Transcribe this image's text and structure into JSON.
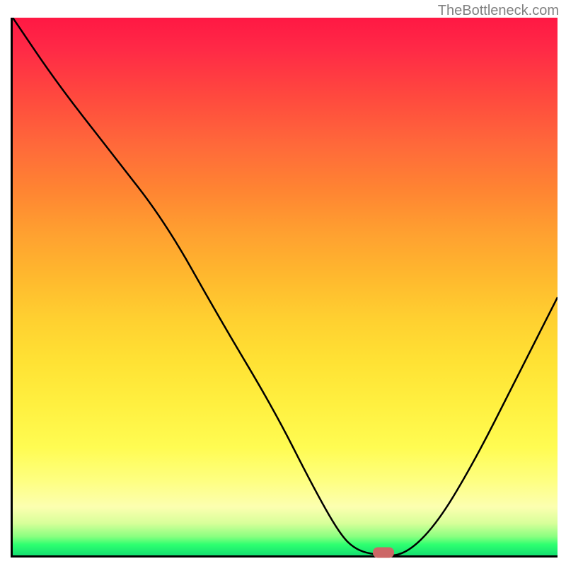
{
  "watermark": "TheBottleneck.com",
  "chart_data": {
    "type": "line",
    "title": "",
    "xlabel": "",
    "ylabel": "",
    "xlim": [
      0,
      100
    ],
    "ylim": [
      0,
      100
    ],
    "x": [
      0,
      8,
      18,
      28,
      38,
      48,
      55,
      60,
      63,
      67,
      72,
      78,
      85,
      92,
      100
    ],
    "y": [
      100,
      88,
      75,
      62,
      44,
      27,
      13,
      4,
      1,
      0,
      0,
      6,
      18,
      32,
      48
    ],
    "marker": {
      "x": 68,
      "y": 0.5
    },
    "background": "rainbow-gradient-red-to-green"
  }
}
